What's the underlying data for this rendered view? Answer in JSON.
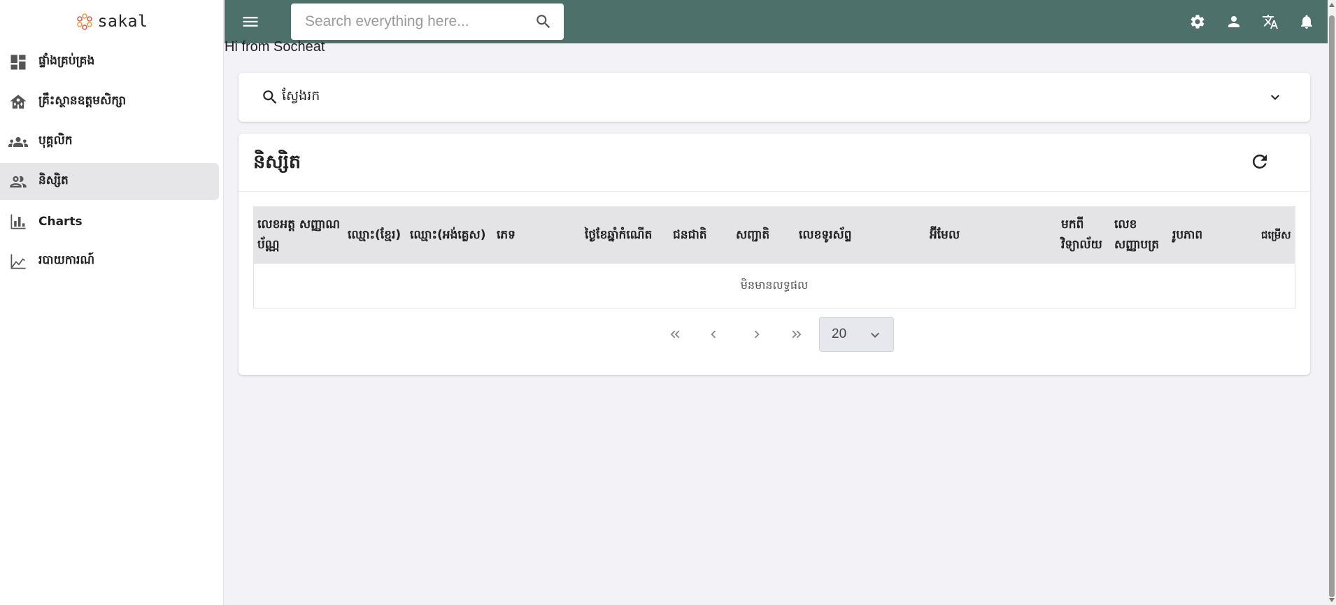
{
  "brand": {
    "name": "sakal"
  },
  "sidebar": {
    "items": [
      {
        "label": "ផ្ទាំងគ្រប់គ្រង",
        "icon": "dashboard-icon"
      },
      {
        "label": "គ្រឹះស្ថានឧត្តមសិក្សា",
        "icon": "institution-icon"
      },
      {
        "label": "បុគ្គលិក",
        "icon": "staff-group-icon"
      },
      {
        "label": "និស្សិត",
        "icon": "students-icon",
        "active": true
      },
      {
        "label": "Charts",
        "icon": "bar-chart-icon"
      },
      {
        "label": "របាយការណ៍",
        "icon": "line-chart-icon"
      }
    ]
  },
  "header": {
    "search_placeholder": "Search everything here...",
    "icons": [
      "gear-icon",
      "user-icon",
      "translate-icon",
      "bell-icon"
    ],
    "background": "#4e706b"
  },
  "greeting": "Hi from Socheat",
  "filter": {
    "label": "ស្វែងរក"
  },
  "students_card": {
    "title": "និស្សិត",
    "columns": [
      "លេខអត្ត សញ្ញាណប័ណ្ណ",
      "ឈ្មោះ(ខ្មែរ)",
      "ឈ្មោះ(អង់គ្លេស)",
      "ភេទ",
      "ថ្ងៃខែឆ្នាំកំណើត",
      "ជនជាតិ",
      "សញ្ជាតិ",
      "លេខទូរស័ព្ទ",
      "អ៊ីមែល",
      "មកពី វិទ្យាល័យ",
      "លេខ សញ្ញាបត្រ",
      "រូបភាព",
      "ជម្រើស"
    ],
    "empty_text": "មិនមានលទ្ធផល",
    "page_size": "20"
  }
}
